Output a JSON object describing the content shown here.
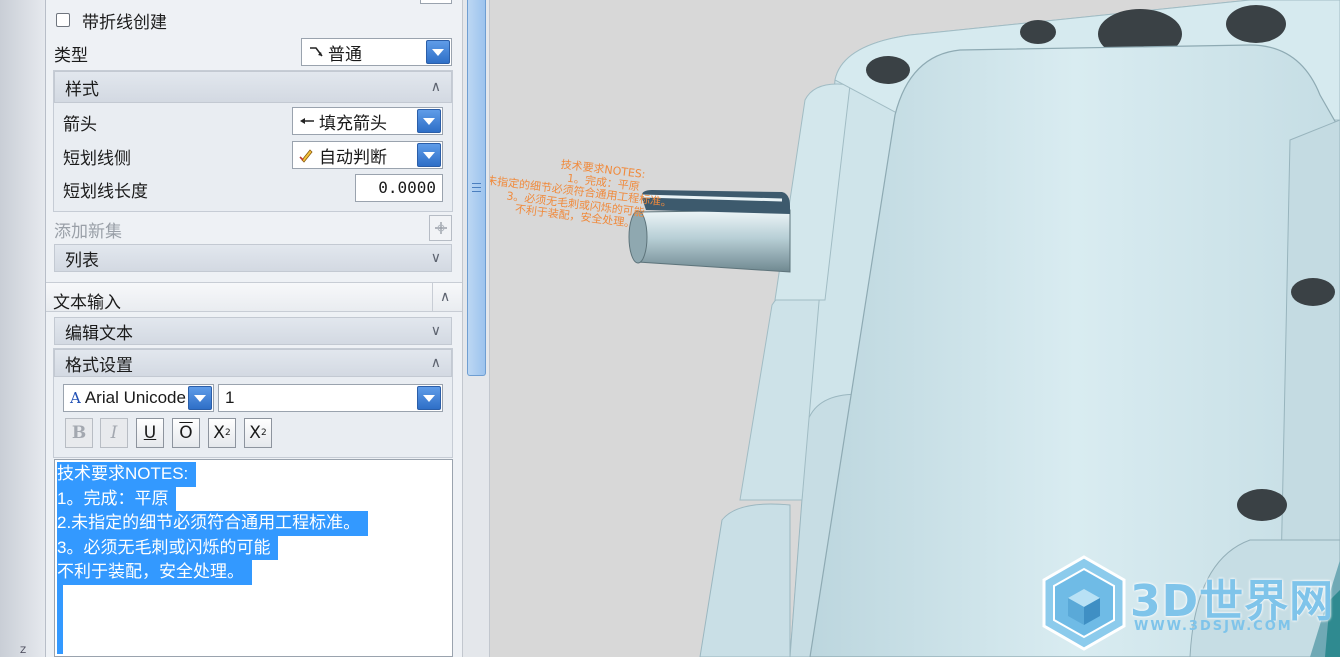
{
  "dialog": {
    "fold_line": {
      "label": "带折线创建",
      "checked": false
    },
    "type": {
      "label": "类型",
      "value": "普通",
      "icon": "leader-line-icon"
    },
    "style_section": {
      "title": "样式",
      "arrow": {
        "label": "箭头",
        "value": "填充箭头",
        "icon": "filled-arrow-icon"
      },
      "stub_side": {
        "label": "短划线侧",
        "value": "自动判断",
        "icon": "auto-infer-icon"
      },
      "stub_length": {
        "label": "短划线长度",
        "value": "0.0000"
      }
    },
    "add_new_set": {
      "label": "添加新集"
    },
    "list_section": {
      "title": "列表"
    },
    "text_input_section": {
      "title": "文本输入"
    },
    "edit_text_section": {
      "title": "编辑文本"
    },
    "format_section": {
      "title": "格式设置",
      "font": {
        "value": "Arial Unicode MS",
        "glyph": "A"
      },
      "size": {
        "value": "1"
      },
      "buttons": {
        "bold": "B",
        "italic": "I",
        "underline": "U",
        "overline": "O",
        "superscript_base": "X",
        "superscript_exp": "2",
        "subscript_base": "X",
        "subscript_exp": "2"
      }
    },
    "text_lines": [
      "技术要求NOTES:",
      "1。完成：平原",
      "2.未指定的细节必须符合通用工程标准。",
      "3。必须无毛刺或闪烁的可能",
      "不利于装配，安全处理。"
    ]
  },
  "viewport": {
    "note_lines": [
      "技术要求NOTES:",
      "1。完成：平原",
      "未指定的细节必须符合通用工程标准。",
      "3。必须无毛刺或闪烁的可能",
      "不利于装配，安全处理。"
    ],
    "watermark": {
      "name": "3D世界网",
      "url": "WWW.3DSJW.COM"
    }
  },
  "left_edge": {
    "axis_label": "Z"
  },
  "colors": {
    "selection": "#3399ff",
    "note_text": "#f08a3c",
    "model_surface": "#cfe4ea",
    "dropdown_button": "#3f82d6"
  }
}
